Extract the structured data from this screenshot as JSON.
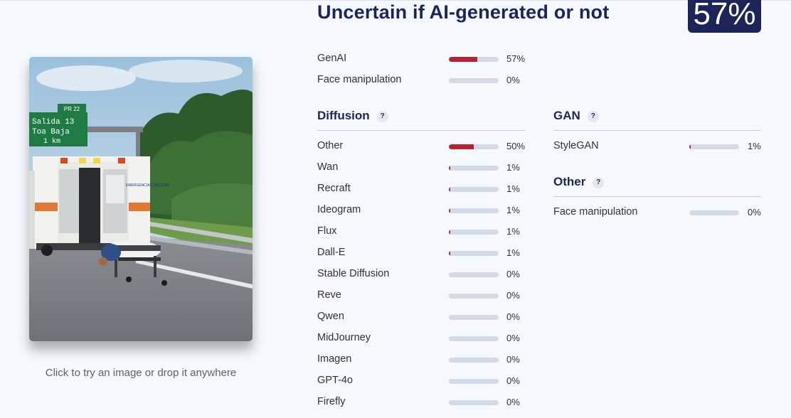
{
  "verdict": "Uncertain if AI-generated or not",
  "score": "57%",
  "drop_hint": "Click to try an image or drop it anywhere",
  "image": {
    "sign_line1": "Salida 13",
    "sign_line2": "Toa Baja",
    "sign_line3": "1 km",
    "sign_tag": "PR 22",
    "ambulance_text": "EMERGENCIAS MÉDICAS"
  },
  "summary": [
    {
      "label": "GenAI",
      "value": "57%",
      "level": 0.57
    },
    {
      "label": "Face manipulation",
      "value": "0%",
      "level": 0.0
    }
  ],
  "diffusion": {
    "title": "Diffusion",
    "help": "?",
    "items": [
      {
        "label": "Other",
        "value": "50%",
        "level": 0.5
      },
      {
        "label": "Wan",
        "value": "1%",
        "level": 0.01
      },
      {
        "label": "Recraft",
        "value": "1%",
        "level": 0.01
      },
      {
        "label": "Ideogram",
        "value": "1%",
        "level": 0.01
      },
      {
        "label": "Flux",
        "value": "1%",
        "level": 0.01
      },
      {
        "label": "Dall-E",
        "value": "1%",
        "level": 0.01
      },
      {
        "label": "Stable Diffusion",
        "value": "0%",
        "level": 0.0
      },
      {
        "label": "Reve",
        "value": "0%",
        "level": 0.0
      },
      {
        "label": "Qwen",
        "value": "0%",
        "level": 0.0
      },
      {
        "label": "MidJourney",
        "value": "0%",
        "level": 0.0
      },
      {
        "label": "Imagen",
        "value": "0%",
        "level": 0.0
      },
      {
        "label": "GPT-4o",
        "value": "0%",
        "level": 0.0
      },
      {
        "label": "Firefly",
        "value": "0%",
        "level": 0.0
      }
    ]
  },
  "gan": {
    "title": "GAN",
    "help": "?",
    "items": [
      {
        "label": "StyleGAN",
        "value": "1%",
        "level": 0.01
      }
    ]
  },
  "other": {
    "title": "Other",
    "help": "?",
    "items": [
      {
        "label": "Face manipulation",
        "value": "0%",
        "level": 0.0
      }
    ]
  },
  "colors": {
    "brand": "#1b2559",
    "bar_fill": "#b8212f",
    "bar_track": "#d3dae6"
  }
}
